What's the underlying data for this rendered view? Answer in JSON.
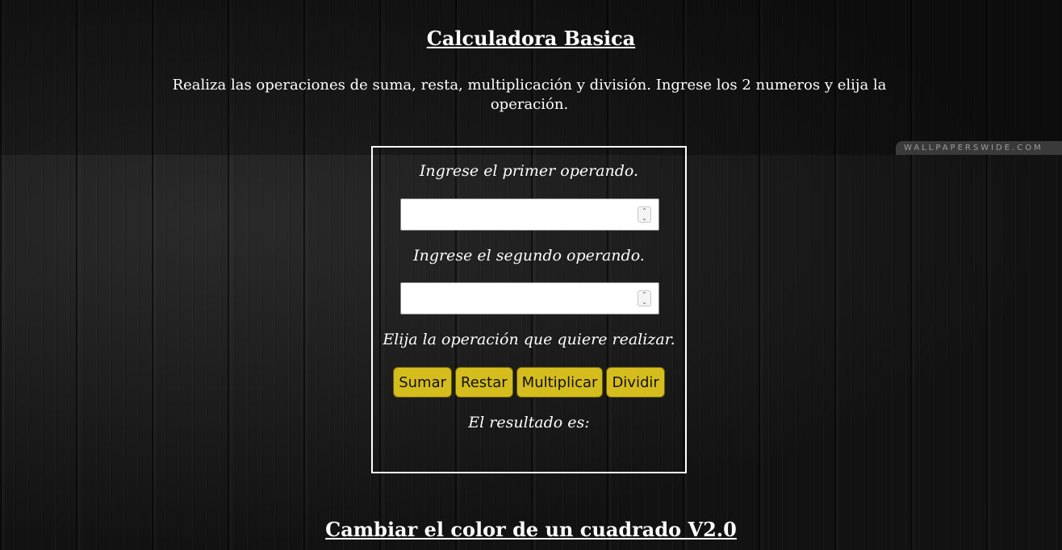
{
  "header": {
    "title": "Calculadora Basica",
    "description": "Realiza las operaciones de suma, resta, multiplicación y división. Ingrese los 2 numeros y elija la operación."
  },
  "watermark": "WALLPAPERSWIDE.COM",
  "calculator": {
    "first_label": "Ingrese el primer operando.",
    "first_value": "",
    "second_label": "Ingrese el segundo operando.",
    "second_value": "",
    "operation_label": "Elija la operación que quiere realizar.",
    "buttons": {
      "sum": "Sumar",
      "subtract": "Restar",
      "multiply": "Multiplicar",
      "divide": "Dividir"
    },
    "result_label": "El resultado es:",
    "button_color": "#d4bd1c"
  },
  "next_section": {
    "title": "Cambiar el color de un cuadrado V2.0"
  }
}
